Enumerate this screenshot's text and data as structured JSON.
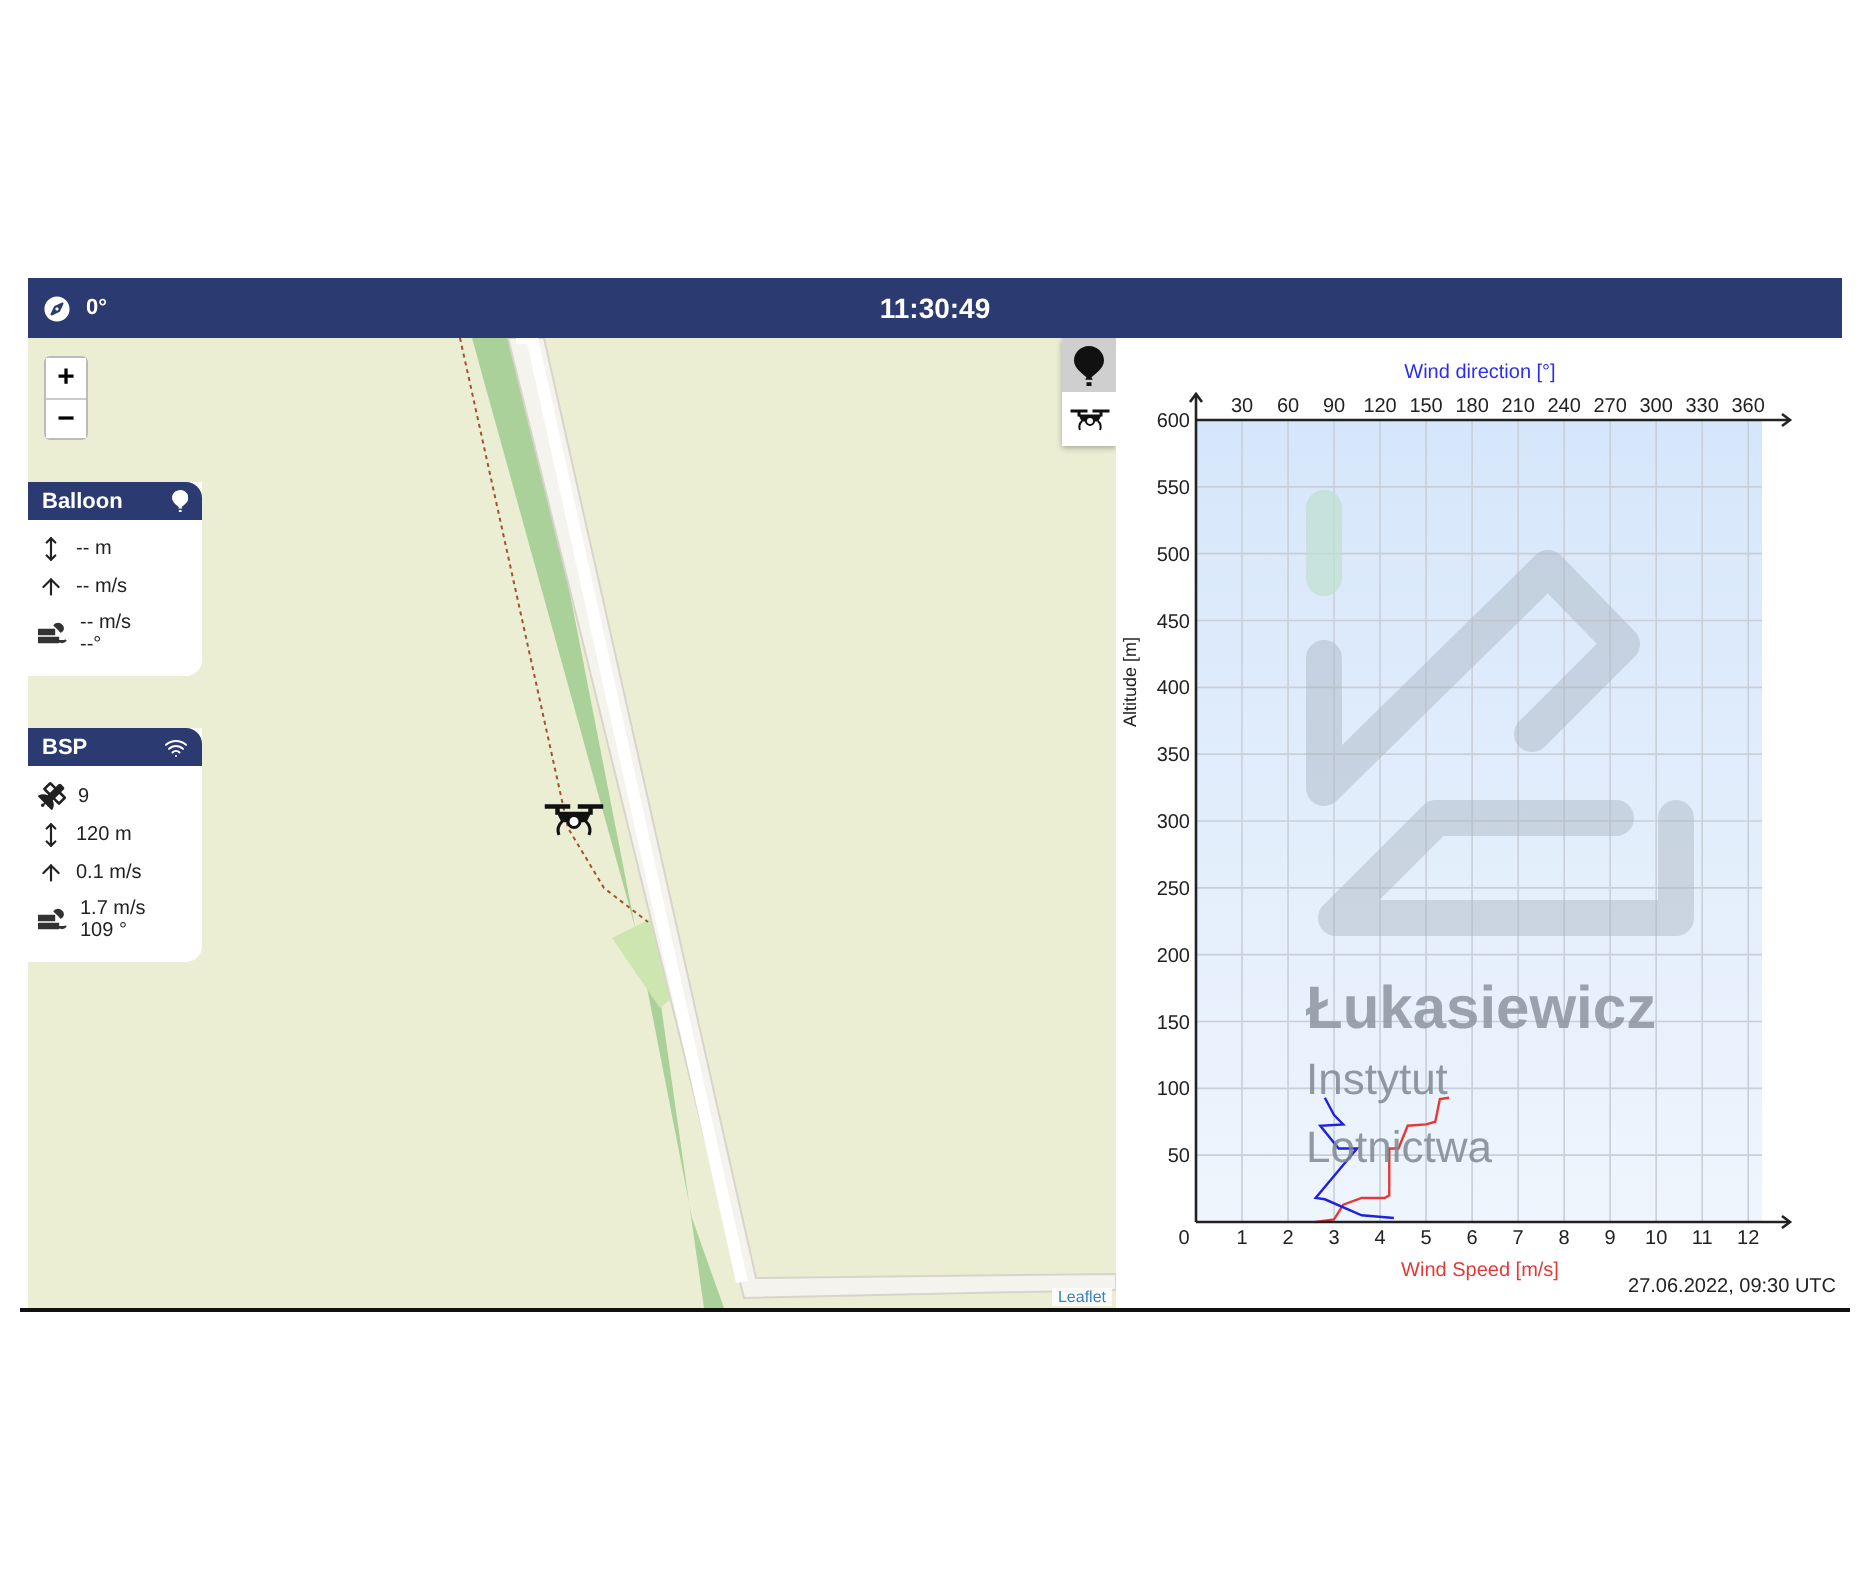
{
  "header": {
    "heading": "0°",
    "time": "11:30:49"
  },
  "map": {
    "zoom_in": "+",
    "zoom_out": "−",
    "attribution": "Leaflet",
    "layers": [
      {
        "kind": "balloon",
        "selected": true
      },
      {
        "kind": "drone",
        "selected": false
      }
    ]
  },
  "panels": [
    {
      "title": "Balloon",
      "kind": "balloon",
      "rows": [
        {
          "kind": "altitude",
          "lines": [
            "-- m"
          ]
        },
        {
          "kind": "vertical_speed",
          "lines": [
            "-- m/s"
          ]
        },
        {
          "kind": "wind",
          "lines": [
            "-- m/s",
            "--°"
          ]
        }
      ]
    },
    {
      "title": "BSP",
      "kind": "signal",
      "rows": [
        {
          "kind": "satellites",
          "lines": [
            "9"
          ]
        },
        {
          "kind": "altitude",
          "lines": [
            "120 m"
          ]
        },
        {
          "kind": "vertical_speed",
          "lines": [
            "0.1 m/s"
          ]
        },
        {
          "kind": "wind",
          "lines": [
            "1.7 m/s",
            "109 °"
          ]
        }
      ]
    }
  ],
  "chart": {
    "watermark": [
      "Łukasiewicz",
      "Instytut",
      "Lotnictwa"
    ],
    "timestamp": "27.06.2022, 09:30 UTC",
    "chart_data": {
      "type": "line",
      "grid": true,
      "xlabel": "Wind Speed [m/s]",
      "ylabel": "Altitude [m]",
      "x2label": "Wind direction [°]",
      "xlim": [
        0,
        12.3
      ],
      "x2lim": [
        0,
        369
      ],
      "ylim": [
        0,
        600
      ],
      "xticks": [
        0,
        1,
        2,
        3,
        4,
        5,
        6,
        7,
        8,
        9,
        10,
        11,
        12
      ],
      "x2ticks": [
        30,
        60,
        90,
        120,
        150,
        180,
        210,
        240,
        270,
        300,
        330,
        360
      ],
      "yticks": [
        50,
        100,
        150,
        200,
        250,
        300,
        350,
        400,
        450,
        500,
        550,
        600
      ],
      "series": [
        {
          "color": "#e53935",
          "x": [
            2.6,
            3,
            3.2,
            3.6,
            4.1,
            4.2,
            4.2,
            4.4,
            4.6,
            5,
            5.2,
            5.3,
            5.5
          ],
          "values": [
            0,
            2,
            13,
            18,
            18,
            20,
            55,
            55,
            72,
            73,
            75,
            92,
            93
          ]
        },
        {
          "axis": "x2",
          "color": "#2020e0",
          "x": [
            129,
            108,
            84,
            78,
            105,
            93,
            81,
            96,
            90,
            84
          ],
          "values": [
            3,
            5,
            17,
            18,
            55,
            55,
            72,
            73,
            80,
            93
          ]
        }
      ]
    }
  }
}
